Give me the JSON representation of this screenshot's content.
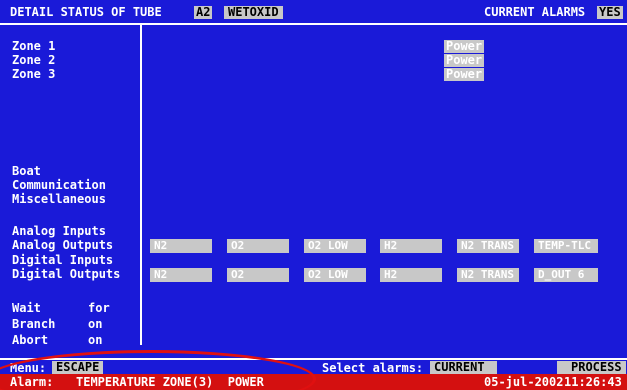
{
  "header": {
    "title": "DETAIL STATUS OF TUBE",
    "tube_id": "A2",
    "process": "WETOXID",
    "alarms_label": "CURRENT ALARMS",
    "alarms_value": "YES"
  },
  "zones": [
    {
      "label": "Zone 1",
      "status": "Power"
    },
    {
      "label": "Zone 2",
      "status": "Power"
    },
    {
      "label": "Zone 3",
      "status": "Power"
    }
  ],
  "misc": {
    "boat": "Boat",
    "communication": "Communication",
    "miscellaneous": "Miscellaneous"
  },
  "io": {
    "analog_inputs": "Analog Inputs",
    "analog_outputs": "Analog Outputs",
    "digital_inputs": "Digital Inputs",
    "digital_outputs": "Digital Outputs",
    "analog_output_channels": [
      "N2",
      "O2",
      "O2 LOW",
      "H2",
      "N2 TRANS",
      "TEMP-TLC"
    ],
    "digital_output_channels": [
      "N2",
      "O2",
      "O2 LOW",
      "H2",
      "N2 TRANS",
      "D_OUT  6"
    ]
  },
  "control": {
    "wait_label": "Wait",
    "wait_value": "for",
    "branch_label": "Branch",
    "branch_value": "on",
    "abort_label": "Abort",
    "abort_value": "on"
  },
  "footer": {
    "menu_label": "Menu:",
    "escape_label": "ESCAPE",
    "select_alarms_label": "Select alarms:",
    "current_label": "CURRENT",
    "process_label": "PROCESS",
    "alarm_label": "Alarm:",
    "alarm_text": "TEMPERATURE ZONE(3)  POWER",
    "date": "05-jul-2002",
    "time": "11:26:43"
  },
  "colors": {
    "screen_bg": "#1a1ad8",
    "alarm_bar": "#d41010",
    "annotation_circle": "#e01010",
    "field_gray": "#c8c8c8"
  }
}
